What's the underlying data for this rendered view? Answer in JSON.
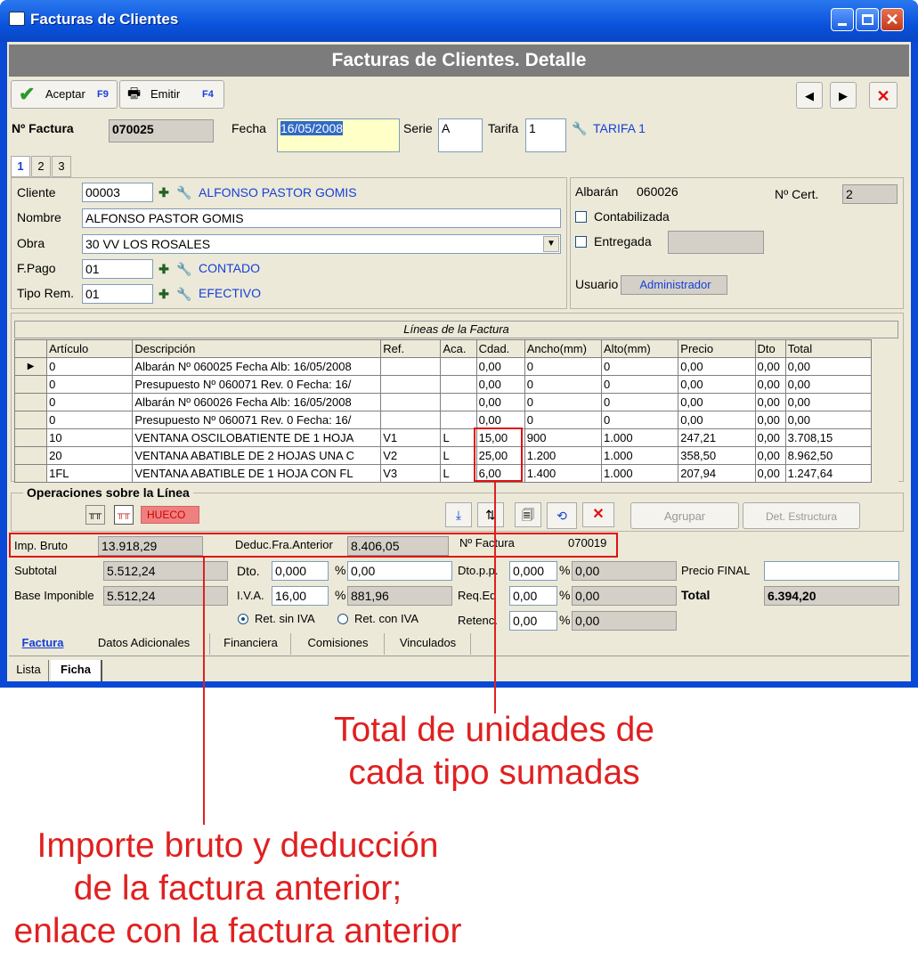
{
  "window": {
    "title": "Facturas de Clientes",
    "banner": "Facturas de Clientes. Detalle"
  },
  "toolbar": {
    "accept_label": "Aceptar",
    "accept_key": "F9",
    "emit_label": "Emitir",
    "emit_key": "F4"
  },
  "header": {
    "invoice_label": "Nº Factura",
    "invoice_value": "070025",
    "date_label": "Fecha",
    "date_value": "16/05/2008",
    "serie_label": "Serie",
    "serie_value": "A",
    "tarifa_label": "Tarifa",
    "tarifa_value": "1",
    "tarifa_name": "TARIFA 1"
  },
  "page_tabs": [
    "1",
    "2",
    "3"
  ],
  "client": {
    "cliente_label": "Cliente",
    "cliente_code": "00003",
    "cliente_name": "ALFONSO PASTOR GOMIS",
    "nombre_label": "Nombre",
    "nombre_value": "ALFONSO PASTOR GOMIS",
    "obra_label": "Obra",
    "obra_value": "30 VV LOS ROSALES",
    "fpago_label": "F.Pago",
    "fpago_code": "01",
    "fpago_name": "CONTADO",
    "tiporem_label": "Tipo Rem.",
    "tiporem_code": "01",
    "tiporem_name": "EFECTIVO"
  },
  "side": {
    "albaran_label": "Albarán",
    "albaran_value": "060026",
    "cert_label": "Nº Cert.",
    "cert_value": "2",
    "contabilizada_label": "Contabilizada",
    "entregada_label": "Entregada",
    "usuario_label": "Usuario",
    "usuario_value": "Administrador"
  },
  "lines": {
    "title": "Líneas de la Factura",
    "columns": [
      "Artículo",
      "Descripción",
      "Ref.",
      "Aca.",
      "Cdad.",
      "Ancho(mm)",
      "Alto(mm)",
      "Precio",
      "Dto",
      "Total"
    ],
    "rows": [
      [
        "0",
        "Albarán Nº 060025  Fecha Alb: 16/05/2008",
        "",
        "",
        "0,00",
        "0",
        "0",
        "0,00",
        "0,00",
        "0,00"
      ],
      [
        "0",
        "Presupuesto Nº 060071 Rev. 0  Fecha: 16/",
        "",
        "",
        "0,00",
        "0",
        "0",
        "0,00",
        "0,00",
        "0,00"
      ],
      [
        "0",
        "Albarán Nº 060026  Fecha Alb: 16/05/2008",
        "",
        "",
        "0,00",
        "0",
        "0",
        "0,00",
        "0,00",
        "0,00"
      ],
      [
        "0",
        "Presupuesto Nº 060071 Rev. 0  Fecha: 16/",
        "",
        "",
        "0,00",
        "0",
        "0",
        "0,00",
        "0,00",
        "0,00"
      ],
      [
        "10",
        "VENTANA OSCILOBATIENTE DE 1 HOJA",
        "V1",
        "L",
        "15,00",
        "900",
        "1.000",
        "247,21",
        "0,00",
        "3.708,15"
      ],
      [
        "20",
        "VENTANA ABATIBLE DE 2 HOJAS UNA C",
        "V2",
        "L",
        "25,00",
        "1.200",
        "1.000",
        "358,50",
        "0,00",
        "8.962,50"
      ],
      [
        "1FL",
        "VENTANA ABATIBLE DE 1 HOJA CON FL",
        "V3",
        "L",
        "6,00",
        "1.400",
        "1.000",
        "207,94",
        "0,00",
        "1.247,64"
      ]
    ]
  },
  "ops": {
    "title": "Operaciones sobre la Línea",
    "hueco_label": "HUECO",
    "agrupar_label": "Agrupar",
    "det_label": "Det. Estructura"
  },
  "totals": {
    "imp_bruto_label": "Imp. Bruto",
    "imp_bruto_value": "13.918,29",
    "deduc_label": "Deduc.Fra.Anterior",
    "deduc_value": "8.406,05",
    "nfact_label": "Nº Factura",
    "nfact_value": "070019",
    "subtotal_label": "Subtotal",
    "subtotal_value": "5.512,24",
    "dto_label": "Dto.",
    "dto_pct": "0,000",
    "dto_value": "0,00",
    "dtopp_label": "Dto.p.p.",
    "dtopp_pct": "0,000",
    "dtopp_value": "0,00",
    "precio_final_label": "Precio FINAL",
    "precio_final_value": "",
    "base_label": "Base Imponible",
    "base_value": "5.512,24",
    "iva_label": "I.V.A.",
    "iva_pct": "16,00",
    "iva_value": "881,96",
    "reqeq_label": "Req.Eq",
    "reqeq_pct": "0,00",
    "reqeq_value": "0,00",
    "total_label": "Total",
    "total_value": "6.394,20",
    "ret_sin_label": "Ret. sin IVA",
    "ret_con_label": "Ret. con IVA",
    "retenc_label": "Retenc.",
    "retenc_pct": "0,00",
    "retenc_value": "0,00",
    "pct": "%"
  },
  "bottom_tabs": [
    "Factura",
    "Datos Adicionales",
    "Financiera",
    "Comisiones",
    "Vinculados"
  ],
  "view_tabs": [
    "Lista",
    "Ficha"
  ],
  "annotations": {
    "units": "Total de unidades de\ncada tipo sumadas",
    "gross": "Importe bruto y deducción\nde la factura anterior;\nenlace con la factura anterior"
  },
  "colors": {
    "annotation": "#e02020",
    "window_blue": "#0a49d6",
    "banner": "#7c7c7c"
  }
}
